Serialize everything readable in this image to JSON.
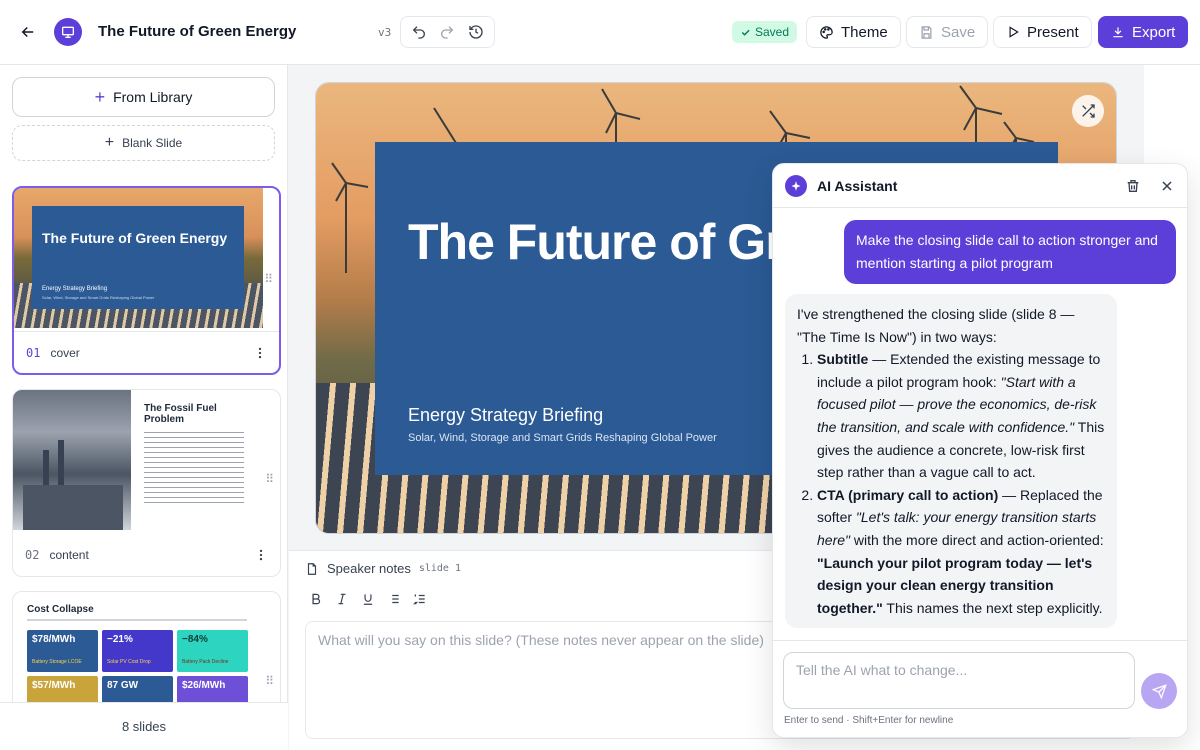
{
  "header": {
    "title": "The Future of Green Energy",
    "version": "v3",
    "saved": "Saved",
    "theme": "Theme",
    "save": "Save",
    "present": "Present",
    "export": "Export"
  },
  "sidebar": {
    "from_library": "From Library",
    "blank_slide": "Blank Slide",
    "slides": [
      {
        "num": "01",
        "label": "cover",
        "thumb_title": "The Future of Green Energy",
        "thumb_sub": "Energy Strategy Briefing",
        "thumb_sub2": "Solar, Wind, Storage and Smart Grids Reshaping Global Power"
      },
      {
        "num": "02",
        "label": "content",
        "thumb_title": "The Fossil Fuel Problem"
      },
      {
        "num": "03",
        "label": "",
        "thumb_title": "Cost Collapse",
        "tiles": [
          "$78/MWh",
          "−21%",
          "−84%",
          "$57/MWh",
          "87 GW",
          "$26/MWh"
        ],
        "tile_labels": [
          "Battery Storage LCOE",
          "Solar PV Cost Drop",
          "Battery Pack Decline"
        ]
      }
    ],
    "count": "8 slides"
  },
  "slide": {
    "title": "The Future of Green Energy",
    "subtitle": "Energy Strategy Briefing",
    "subtitle2": "Solar, Wind, Storage and Smart Grids Reshaping Global Power"
  },
  "notes": {
    "label": "Speaker notes",
    "slide_ref": "slide 1",
    "placeholder": "What will you say on this slide? (These notes never appear on the slide)"
  },
  "ai": {
    "title": "AI Assistant",
    "user_msg": "Make the closing slide call to action stronger and mention starting a pilot program",
    "bot_intro": "I've strengthened the closing slide (slide 8 — \"The Time Is Now\") in two ways:",
    "item1_head": "Subtitle",
    "item1_a": " — Extended the existing message to include a pilot program hook: ",
    "item1_quote": "\"Start with a focused pilot — prove the economics, de-risk the transition, and scale with confidence.\"",
    "item1_b": " This gives the audience a concrete, low-risk first step rather than a vague call to act.",
    "item2_head": "CTA (primary call to action)",
    "item2_a": " — Replaced the softer ",
    "item2_quote": "\"Let's talk: your energy transition starts here\"",
    "item2_b": " with the more direct and action-oriented: ",
    "item2_bold": "\"Launch your pilot program today — let's design your clean energy transition together.\"",
    "item2_c": " This names the next step explicitly.",
    "input_placeholder": "Tell the AI what to change...",
    "hint": "Enter to send · Shift+Enter for newline"
  }
}
